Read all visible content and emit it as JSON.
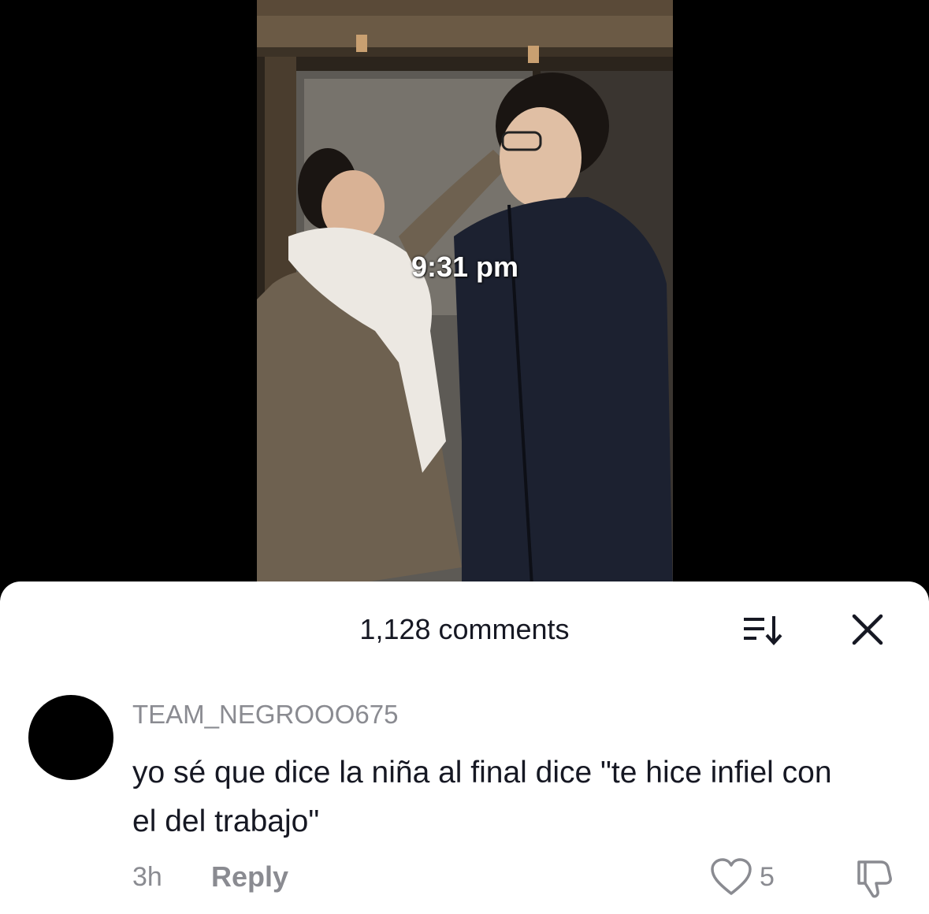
{
  "video": {
    "overlay_text": "9:31 pm"
  },
  "comments_panel": {
    "count_label": "1,128 comments",
    "sort_icon": "sort-icon",
    "close_icon": "close-icon"
  },
  "comment": {
    "username": "TEAM_NEGROOO675",
    "text": "yo sé que dice la niña al final dice \"te hice infiel con el del trabajo\"",
    "time": "3h",
    "reply_label": "Reply",
    "like_count": "5",
    "like_icon": "heart-outline-icon",
    "dislike_icon": "thumbs-down-icon"
  },
  "colors": {
    "sheet_bg": "#ffffff",
    "primary_text": "#161823",
    "secondary_text": "#8a8b91"
  }
}
